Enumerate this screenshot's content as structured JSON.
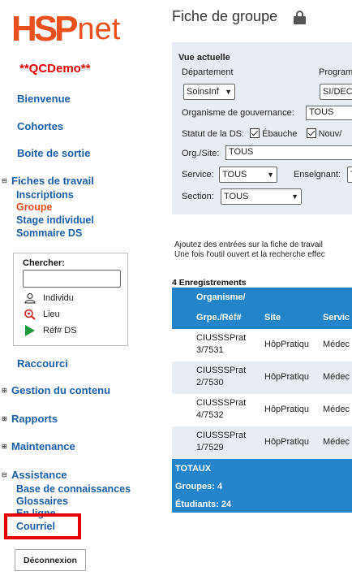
{
  "logo": {
    "part1": "HSP",
    "part2": "net"
  },
  "demo_label": "**QCDemo**",
  "sidebar": {
    "links": {
      "bienvenue": "Bienvenue",
      "cohortes": "Cohortes",
      "boite": "Boite de sortie",
      "raccourci": "Raccourci"
    },
    "fiches": {
      "label": "Fiches de travail",
      "items": [
        "Inscriptions",
        "Groupe",
        "Stage individuel",
        "Sommaire DS"
      ]
    },
    "search": {
      "title": "Chercher:",
      "value": "",
      "options": [
        "Individu",
        "Lieu",
        "Réf# DS"
      ]
    },
    "groups": {
      "gestion": "Gestion du contenu",
      "rapports": "Rapports",
      "maintenance": "Maintenance",
      "assistance": "Assistance"
    },
    "assistance_items": [
      "Base de connaissances",
      "Glossaires",
      "En ligne",
      "Courriel"
    ],
    "logout": "Déconnexion"
  },
  "main": {
    "title": "Fiche de groupe",
    "panel": {
      "heading": "Vue actuelle",
      "dept_label": "Département",
      "prog_label": "Program",
      "dept_value": "SoinsInf",
      "prog_value": "SI/DEC",
      "org_gov_label": "Organisme de gouvernance:",
      "org_gov_value": "TOUS",
      "status_label": "Statut de la DS:",
      "status_opt1": "Ébauche",
      "status_opt2": "Nouv/",
      "orgsite_label": "Org./Site:",
      "orgsite_value": "TOUS",
      "service_label": "Service:",
      "service_value": "TOUS",
      "teacher_label": "Enseignant:",
      "teacher_value": "T",
      "section_label": "Section:",
      "section_value": "TOUS"
    },
    "info_lines": [
      "Ajoutez des entrées sur la fiche de travail",
      "Une fois l'outil ouvert et la recherche effec"
    ],
    "records_label": "4 Enregistrements",
    "table": {
      "headers": {
        "org_line1": "Organisme/",
        "org_line2": "Grpe./Réf#",
        "site": "Site",
        "service": "Servic"
      },
      "rows": [
        {
          "org": "CIUSSSPrat",
          "ref": "3/7531",
          "site": "HôpPratiqu",
          "service": "Médec"
        },
        {
          "org": "CIUSSSPrat",
          "ref": "2/7530",
          "site": "HôpPratiqu",
          "service": "Médec"
        },
        {
          "org": "CIUSSSPrat",
          "ref": "4/7532",
          "site": "HôpPratiqu",
          "service": "Médec"
        },
        {
          "org": "CIUSSSPrat",
          "ref": "1/7529",
          "site": "HôpPratiqu",
          "service": "Médec"
        }
      ],
      "totals": {
        "label": "TOTAUX",
        "groups": "Groupes: 4",
        "students": "Étudiants: 24"
      }
    }
  },
  "colors": {
    "brand": "#e8501e",
    "link": "#1a5ea8",
    "header": "#2384c9",
    "demo": "#e00000",
    "highlight": "#e60000"
  }
}
